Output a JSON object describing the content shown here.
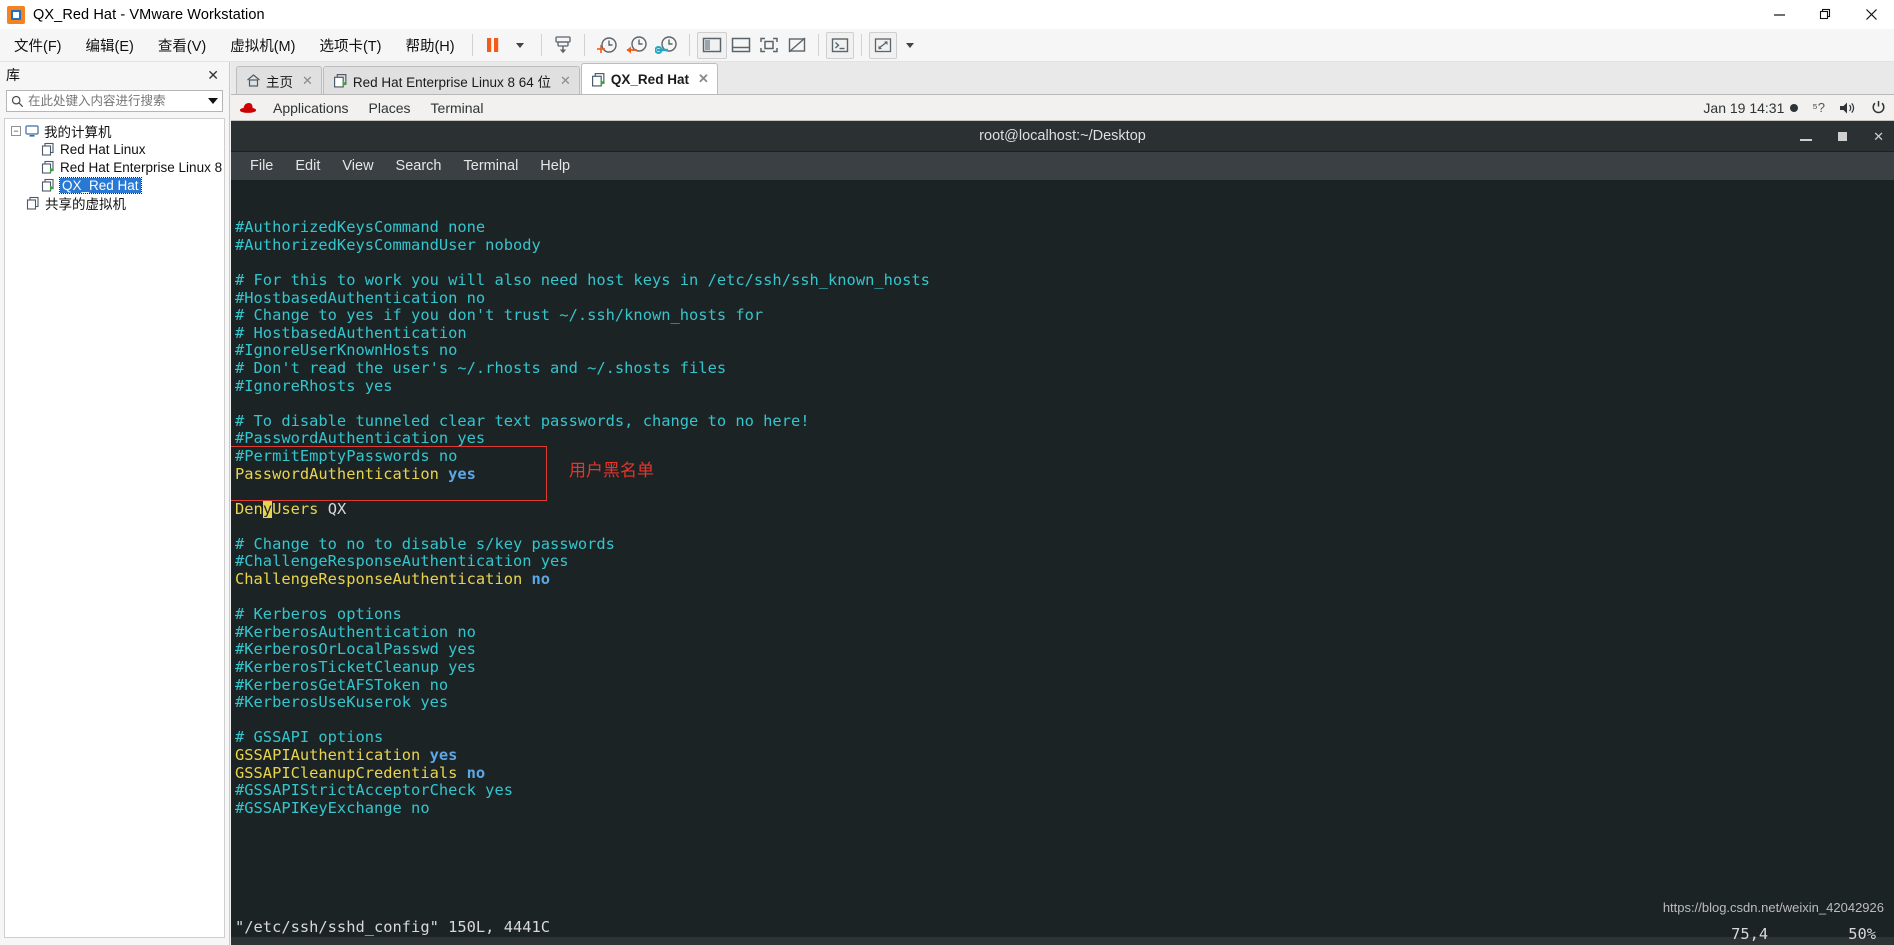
{
  "window": {
    "title": "QX_Red Hat - VMware Workstation",
    "logo_icon": "vmware-logo-icon",
    "controls": [
      {
        "name": "minimize",
        "glyph": "—"
      },
      {
        "name": "restore",
        "glyph": "❐"
      },
      {
        "name": "close",
        "glyph": "✕"
      }
    ]
  },
  "menubar": {
    "items": [
      {
        "label": "文件(F)",
        "name": "menu-file"
      },
      {
        "label": "编辑(E)",
        "name": "menu-edit"
      },
      {
        "label": "查看(V)",
        "name": "menu-view"
      },
      {
        "label": "虚拟机(M)",
        "name": "menu-vm"
      },
      {
        "label": "选项卡(T)",
        "name": "menu-tabs"
      },
      {
        "label": "帮助(H)",
        "name": "menu-help"
      }
    ],
    "toolbar": [
      {
        "name": "suspend-button",
        "icon": "pause-icon"
      },
      {
        "name": "power-dropdown",
        "icon": "caret-down-icon"
      },
      {
        "name": "snapshot-button",
        "icon": "snapshot-icon"
      },
      {
        "name": "take-snapshot-button",
        "icon": "clock-plus-icon"
      },
      {
        "name": "revert-snapshot-button",
        "icon": "clock-back-icon"
      },
      {
        "name": "snapshot-manager-button",
        "icon": "clock-wrench-icon"
      },
      {
        "name": "show-library-button",
        "icon": "sidebar-icon"
      },
      {
        "name": "show-thumbnails-button",
        "icon": "bottom-panel-icon"
      },
      {
        "name": "fullscreen-button",
        "icon": "fullscreen-icon"
      },
      {
        "name": "unity-button",
        "icon": "unity-off-icon"
      },
      {
        "name": "console-button",
        "icon": "terminal-prompt-icon"
      },
      {
        "name": "stretch-button",
        "icon": "expand-arrows-icon"
      },
      {
        "name": "stretch-dropdown",
        "icon": "caret-down-icon"
      }
    ]
  },
  "library": {
    "title": "库",
    "close_label": "✕",
    "search": {
      "placeholder": "在此处键入内容进行搜索",
      "value": "",
      "icon": "search-icon"
    },
    "tree": [
      {
        "label": "我的计算机",
        "level": 0,
        "icon": "computer-icon",
        "expander": "−",
        "selected": false
      },
      {
        "label": "Red Hat Linux",
        "level": 1,
        "icon": "vm-icon",
        "selected": false
      },
      {
        "label": "Red Hat Enterprise Linux 8",
        "level": 1,
        "icon": "vm-running-icon",
        "selected": false
      },
      {
        "label": "QX_Red Hat",
        "level": 1,
        "icon": "vm-running-icon",
        "selected": true
      },
      {
        "label": "共享的虚拟机",
        "level": 0,
        "icon": "shared-vm-icon",
        "selected": false
      }
    ]
  },
  "tabs": [
    {
      "label": "主页",
      "icon": "home-icon",
      "active": false,
      "close": "✕"
    },
    {
      "label": "Red Hat Enterprise Linux 8 64 位",
      "icon": "vm-running-icon",
      "active": false,
      "close": "✕"
    },
    {
      "label": "QX_Red Hat",
      "icon": "vm-running-icon",
      "active": true,
      "close": "✕"
    }
  ],
  "guest": {
    "panel": {
      "logo_icon": "redhat-icon",
      "items": [
        "Applications",
        "Places",
        "Terminal"
      ],
      "clock": "Jan 19  14:31",
      "recording_icon": "record-dot-icon",
      "tray": [
        {
          "name": "input-method-icon",
          "glyph": "?"
        },
        {
          "name": "volume-icon",
          "glyph": "🔊"
        },
        {
          "name": "power-icon",
          "glyph": "⏻"
        }
      ]
    },
    "terminal": {
      "title": "root@localhost:~/Desktop",
      "controls": [
        {
          "name": "minimize-window-button",
          "glyph": "—"
        },
        {
          "name": "maximize-window-button",
          "glyph": "▪"
        },
        {
          "name": "close-window-button",
          "glyph": "✕"
        }
      ],
      "menus": [
        "File",
        "Edit",
        "View",
        "Search",
        "Terminal",
        "Help"
      ],
      "lines": [
        [
          {
            "t": "#AuthorizedKeysCommand none",
            "c": "comment"
          }
        ],
        [
          {
            "t": "#AuthorizedKeysCommandUser nobody",
            "c": "comment"
          }
        ],
        [
          {
            "t": "",
            "c": "plain"
          }
        ],
        [
          {
            "t": "# For this to work you will also need host keys in /etc/ssh/ssh_known_hosts",
            "c": "comment"
          }
        ],
        [
          {
            "t": "#HostbasedAuthentication no",
            "c": "comment"
          }
        ],
        [
          {
            "t": "# Change to yes if you don't trust ~/.ssh/known_hosts for",
            "c": "comment"
          }
        ],
        [
          {
            "t": "# HostbasedAuthentication",
            "c": "comment"
          }
        ],
        [
          {
            "t": "#IgnoreUserKnownHosts no",
            "c": "comment"
          }
        ],
        [
          {
            "t": "# Don't read the user's ~/.rhosts and ~/.shosts files",
            "c": "comment"
          }
        ],
        [
          {
            "t": "#IgnoreRhosts yes",
            "c": "comment"
          }
        ],
        [
          {
            "t": "",
            "c": "plain"
          }
        ],
        [
          {
            "t": "# To disable tunneled clear text passwords, change to no here!",
            "c": "comment"
          }
        ],
        [
          {
            "t": "#PasswordAuthentication yes",
            "c": "comment"
          }
        ],
        [
          {
            "t": "#PermitEmptyPasswords no",
            "c": "comment"
          }
        ],
        [
          {
            "t": "PasswordAuthentication ",
            "c": "key"
          },
          {
            "t": "yes",
            "c": "val"
          }
        ],
        [
          {
            "t": "",
            "c": "plain"
          }
        ],
        [
          {
            "t": "Den",
            "c": "key"
          },
          {
            "t": "y",
            "c": "cursor"
          },
          {
            "t": "Users",
            "c": "key"
          },
          {
            "t": " QX",
            "c": "plain"
          }
        ],
        [
          {
            "t": "",
            "c": "plain"
          }
        ],
        [
          {
            "t": "# Change to no to disable s/key passwords",
            "c": "comment"
          }
        ],
        [
          {
            "t": "#ChallengeResponseAuthentication yes",
            "c": "comment"
          }
        ],
        [
          {
            "t": "ChallengeResponseAuthentication ",
            "c": "key"
          },
          {
            "t": "no",
            "c": "val"
          }
        ],
        [
          {
            "t": "",
            "c": "plain"
          }
        ],
        [
          {
            "t": "# Kerberos options",
            "c": "comment"
          }
        ],
        [
          {
            "t": "#KerberosAuthentication no",
            "c": "comment"
          }
        ],
        [
          {
            "t": "#KerberosOrLocalPasswd yes",
            "c": "comment"
          }
        ],
        [
          {
            "t": "#KerberosTicketCleanup yes",
            "c": "comment"
          }
        ],
        [
          {
            "t": "#KerberosGetAFSToken no",
            "c": "comment"
          }
        ],
        [
          {
            "t": "#KerberosUseKuserok yes",
            "c": "comment"
          }
        ],
        [
          {
            "t": "",
            "c": "plain"
          }
        ],
        [
          {
            "t": "# GSSAPI options",
            "c": "comment"
          }
        ],
        [
          {
            "t": "GSSAPIAuthentication ",
            "c": "key"
          },
          {
            "t": "yes",
            "c": "val"
          }
        ],
        [
          {
            "t": "GSSAPICleanupCredentials ",
            "c": "key"
          },
          {
            "t": "no",
            "c": "val"
          }
        ],
        [
          {
            "t": "#GSSAPIStrictAcceptorCheck yes",
            "c": "comment"
          }
        ],
        [
          {
            "t": "#GSSAPIKeyExchange no",
            "c": "comment"
          }
        ]
      ],
      "status_line": "\"/etc/ssh/sshd_config\" 150L, 4441C",
      "ruler_pos": "75,4",
      "ruler_pct": "50%",
      "annotation": {
        "text": "用户黑名单",
        "box_color": "#e03b33",
        "text_color": "#e8342a"
      }
    }
  },
  "watermark": "https://blog.csdn.net/weixin_42042926",
  "colors": {
    "terminal_bg": "#1c2325",
    "comment": "#34c5cd",
    "key": "#e8d44d",
    "value": "#5ca7e6",
    "accent_orange": "#f58220",
    "selection_blue": "#2979d4",
    "annotation_red": "#e03b33"
  }
}
